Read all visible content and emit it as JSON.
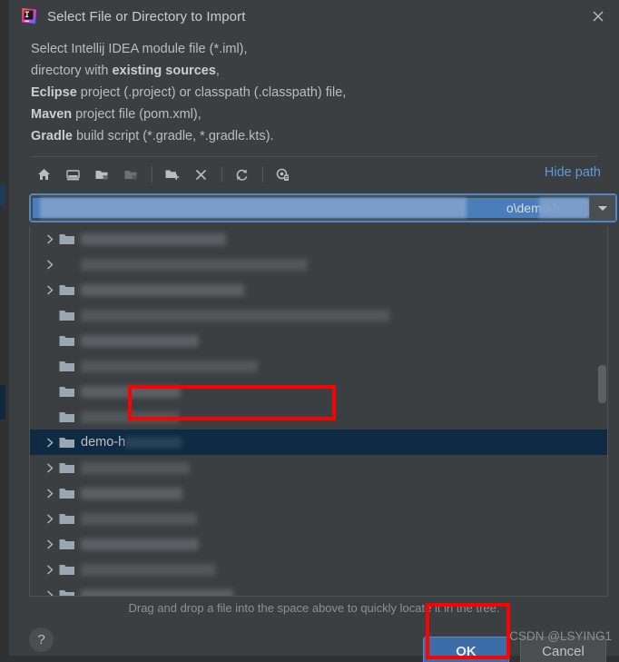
{
  "window": {
    "title": "Select File or Directory to Import",
    "app_icon": "intellij-idea-icon",
    "close_icon": "close-icon"
  },
  "description": {
    "line1_prefix": "Select Intellij IDEA module file (*.iml),",
    "line2_prefix": "directory with ",
    "line2_bold": "existing sources",
    "line2_suffix": ",",
    "line3_bold": "Eclipse",
    "line3_suffix": " project (.project) or classpath (.classpath) file,",
    "line4_bold": "Maven",
    "line4_suffix": " project file (pom.xml),",
    "line5_bold": "Gradle",
    "line5_suffix": " build script (*.gradle, *.gradle.kts)."
  },
  "toolbar": {
    "hide_path_label": "Hide path",
    "buttons": [
      {
        "name": "home-icon",
        "title": "Home"
      },
      {
        "name": "desktop-icon",
        "title": "Desktop"
      },
      {
        "name": "expand-folder-icon",
        "title": "Expand"
      },
      {
        "name": "collapse-folder-icon",
        "title": "Collapse"
      },
      {
        "name": "new-folder-icon",
        "title": "New Folder"
      },
      {
        "name": "delete-icon",
        "title": "Delete"
      },
      {
        "name": "refresh-icon",
        "title": "Refresh"
      },
      {
        "name": "show-hidden-files-icon",
        "title": "Show Hidden Files"
      }
    ]
  },
  "path_field": {
    "value": "o\\demo-h",
    "placeholder": "",
    "dropdown_icon": "chevron-down-icon",
    "selected": true
  },
  "tree": {
    "rows": [
      {
        "id": "row-1",
        "expandable": true,
        "has_folder_icon": true,
        "label": "",
        "redacted_width": 160,
        "indent": 0,
        "selected": false
      },
      {
        "id": "row-2",
        "expandable": true,
        "has_folder_icon": false,
        "label": "",
        "redacted_width": 250,
        "indent": 0,
        "selected": false
      },
      {
        "id": "row-3",
        "expandable": true,
        "has_folder_icon": true,
        "label": "",
        "redacted_width": 180,
        "indent": 0,
        "selected": false
      },
      {
        "id": "row-4",
        "expandable": false,
        "has_folder_icon": true,
        "label": "",
        "redacted_width": 340,
        "indent": 0,
        "selected": false
      },
      {
        "id": "row-5",
        "expandable": false,
        "has_folder_icon": true,
        "label": "",
        "redacted_width": 130,
        "indent": 0,
        "selected": false
      },
      {
        "id": "row-6",
        "expandable": false,
        "has_folder_icon": true,
        "label": "",
        "redacted_width": 195,
        "indent": 0,
        "selected": false
      },
      {
        "id": "row-7",
        "expandable": false,
        "has_folder_icon": true,
        "label": "",
        "redacted_width": 110,
        "indent": 0,
        "selected": false
      },
      {
        "id": "row-8",
        "expandable": false,
        "has_folder_icon": true,
        "label": "",
        "redacted_width": 108,
        "indent": 0,
        "selected": false
      },
      {
        "id": "row-9",
        "expandable": true,
        "has_folder_icon": true,
        "label": "demo-h",
        "redacted_width": 62,
        "indent": 0,
        "selected": true
      },
      {
        "id": "row-10",
        "expandable": true,
        "has_folder_icon": true,
        "label": "",
        "redacted_width": 120,
        "indent": 0,
        "selected": false
      },
      {
        "id": "row-11",
        "expandable": true,
        "has_folder_icon": true,
        "label": "",
        "redacted_width": 112,
        "indent": 0,
        "selected": false
      },
      {
        "id": "row-12",
        "expandable": true,
        "has_folder_icon": true,
        "label": "",
        "redacted_width": 128,
        "indent": 0,
        "selected": false
      },
      {
        "id": "row-13",
        "expandable": true,
        "has_folder_icon": true,
        "label": "",
        "redacted_width": 130,
        "indent": 0,
        "selected": false
      },
      {
        "id": "row-14",
        "expandable": true,
        "has_folder_icon": true,
        "label": "",
        "redacted_width": 148,
        "indent": 0,
        "selected": false
      },
      {
        "id": "row-15",
        "expandable": true,
        "has_folder_icon": true,
        "label": "",
        "redacted_width": 168,
        "indent": 0,
        "selected": false
      },
      {
        "id": "row-16",
        "expandable": true,
        "has_folder_icon": true,
        "label": "",
        "redacted_width": 170,
        "indent": 0,
        "selected": false
      },
      {
        "id": "row-17",
        "expandable": true,
        "has_folder_icon": true,
        "label": "",
        "redacted_width": 152,
        "indent": 0,
        "selected": false
      }
    ]
  },
  "footer": {
    "hint": "Drag and drop a file into the space above to quickly locate it in the tree.",
    "help_label": "?",
    "ok_label": "OK",
    "cancel_label": "Cancel"
  },
  "watermark": "CSDN @LSYING1",
  "annotations": [
    {
      "name": "tree-selection-highlight",
      "color": "#fe0000"
    },
    {
      "name": "ok-button-highlight",
      "color": "#fe0000"
    }
  ],
  "colors": {
    "dialog_bg": "#3c3f41",
    "selection_row": "#0e2b43",
    "accent_blue": "#4a88c7",
    "link_blue": "#5a9cd8",
    "primary_button": "#3c6da8",
    "annotation_red": "#fe0000"
  }
}
